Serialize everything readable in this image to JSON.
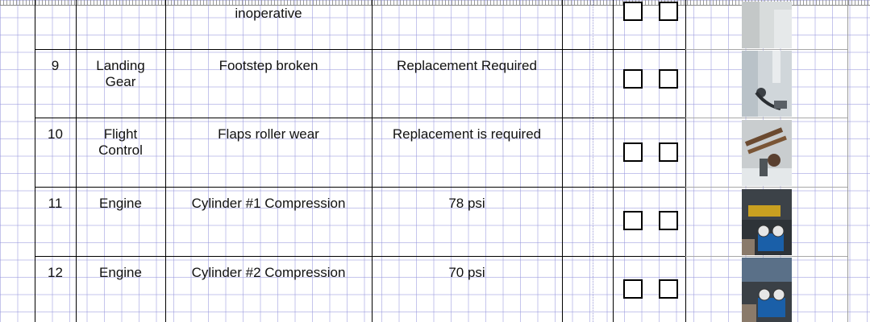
{
  "top_row": {
    "description": "inoperative"
  },
  "rows": [
    {
      "no": "9",
      "system": "Landing Gear",
      "system_lines": [
        "Landing",
        "Gear"
      ],
      "description": "Footstep broken",
      "action": "Replacement Required",
      "photo": "landing-gear-footstep-photo"
    },
    {
      "no": "10",
      "system": "Flight Control",
      "system_lines": [
        "Flight",
        "Control"
      ],
      "description": "Flaps roller wear",
      "action": "Replacement is required",
      "photo": "flap-roller-photo"
    },
    {
      "no": "11",
      "system": "Engine",
      "system_lines": [
        "Engine",
        ""
      ],
      "description": "Cylinder #1 Compression",
      "action": "78 psi",
      "photo": "compression-gauge-photo"
    },
    {
      "no": "12",
      "system": "Engine",
      "system_lines": [
        "Engine",
        ""
      ],
      "description": "Cylinder #2 Compression",
      "action": "70 psi",
      "photo": "compression-gauge-photo"
    }
  ],
  "colors": {
    "grid": "#9696dc",
    "border": "#000000",
    "photo_border": "#a8a8a8"
  }
}
